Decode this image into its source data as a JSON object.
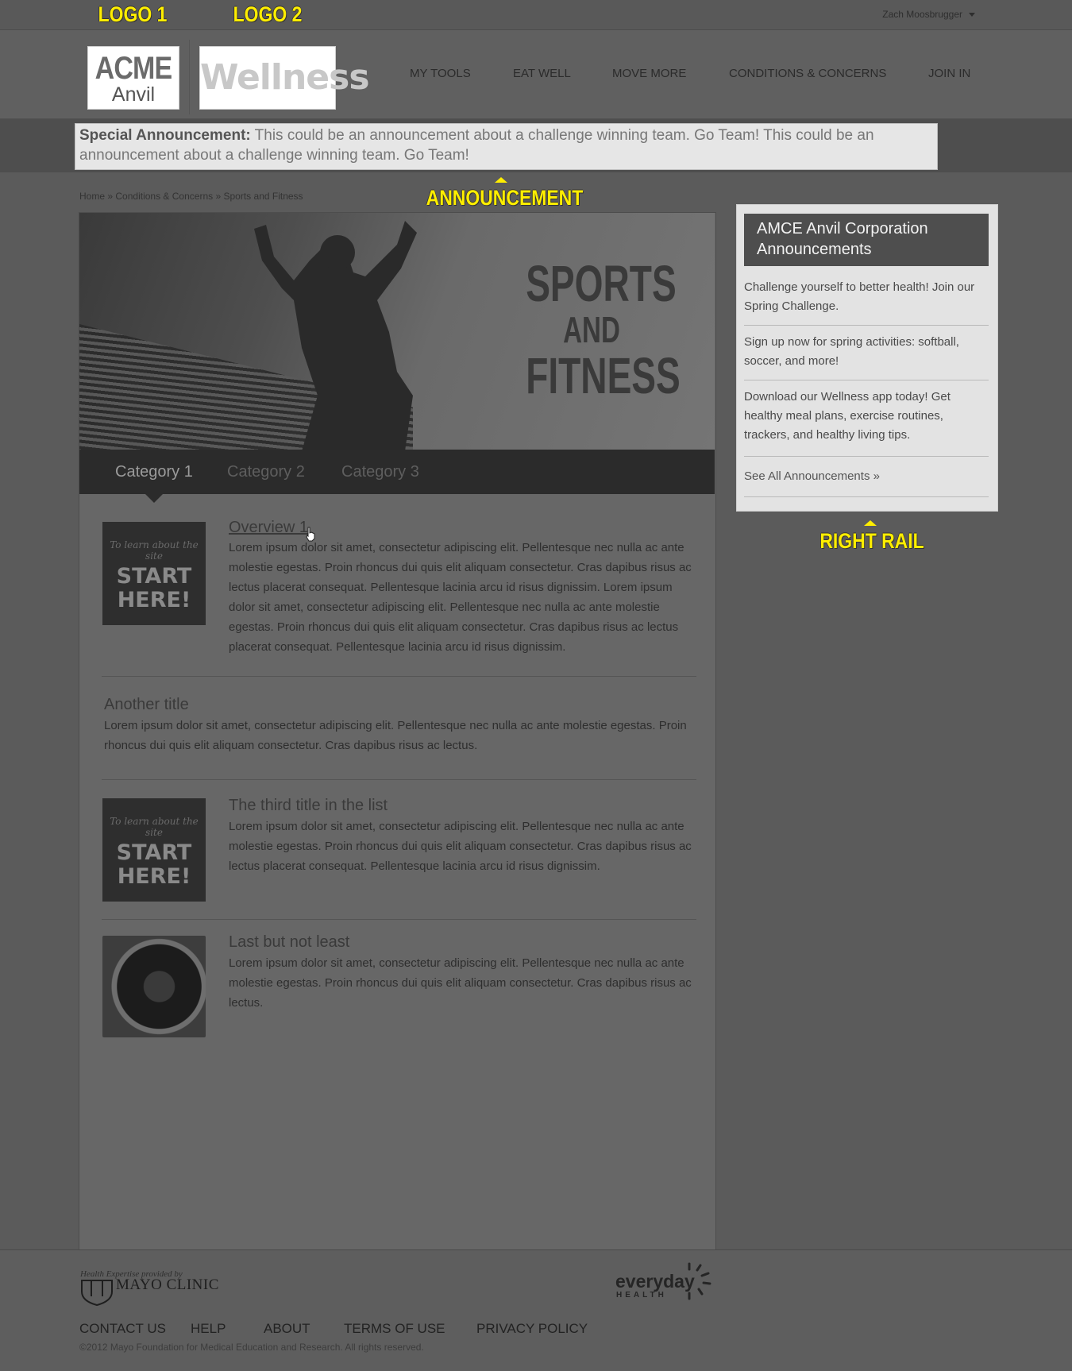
{
  "annotations": {
    "logo1": "LOGO 1",
    "logo2": "LOGO 2",
    "announcement": "ANNOUNCEMENT",
    "right_rail": "RIGHT RAIL"
  },
  "user": {
    "name": "Zach Moosbrugger"
  },
  "logos": {
    "acme_line1": "ACME",
    "acme_line2": "Anvil",
    "wellness": "Wellness"
  },
  "nav": [
    "MY TOOLS",
    "EAT WELL",
    "MOVE MORE",
    "CONDITIONS & CONCERNS",
    "JOIN IN"
  ],
  "announcement": {
    "label": "Special Announcement:",
    "text": " This could be an announcement about a challenge winning team. Go Team! This could be an announcement about a challenge winning team. Go Team!"
  },
  "breadcrumb": [
    "Home",
    "Conditions & Concerns",
    "Sports and Fitness"
  ],
  "breadcrumb_sep": "»",
  "hero": {
    "line1": "SPORTS",
    "line2": "AND",
    "line3": "FITNESS"
  },
  "tabs": [
    "Category 1",
    "Category 2",
    "Category 3"
  ],
  "thumb": {
    "small": "To learn about the site",
    "big1": "START",
    "big2": "HERE!"
  },
  "items": [
    {
      "title": "Overview 1",
      "body": "Lorem ipsum dolor sit amet, consectetur adipiscing elit. Pellentesque nec nulla ac ante molestie egestas. Proin rhoncus dui quis elit aliquam consectetur. Cras dapibus risus ac lectus placerat consequat. Pellentesque lacinia arcu id risus dignissim. Lorem ipsum dolor sit amet, consectetur adipiscing elit. Pellentesque nec nulla ac ante molestie egestas. Proin rhoncus dui quis elit aliquam consectetur. Cras dapibus risus ac lectus placerat consequat. Pellentesque lacinia arcu id risus dignissim."
    },
    {
      "title": "Another title",
      "body": "Lorem ipsum dolor sit amet, consectetur adipiscing elit. Pellentesque nec nulla ac ante molestie egestas. Proin rhoncus dui quis elit aliquam consectetur. Cras dapibus risus ac lectus."
    },
    {
      "title": "The third title in the list",
      "body": "Lorem ipsum dolor sit amet, consectetur adipiscing elit. Pellentesque nec nulla ac ante molestie egestas. Proin rhoncus dui quis elit aliquam consectetur. Cras dapibus risus ac lectus placerat consequat. Pellentesque lacinia arcu id risus dignissim."
    },
    {
      "title": "Last but not least",
      "body": "Lorem ipsum dolor sit amet, consectetur adipiscing elit. Pellentesque nec nulla ac ante molestie egestas. Proin rhoncus dui quis elit aliquam consectetur. Cras dapibus risus ac lectus."
    }
  ],
  "rail": {
    "title": "AMCE Anvil Corporation Announcements",
    "items": [
      "Challenge yourself to better health! Join our Spring Challenge.",
      "Sign up now for spring activities: softball, soccer, and more!",
      "Download our Wellness app today! Get healthy meal plans, exercise routines, trackers, and healthy living tips."
    ],
    "link": "See All Announcements »"
  },
  "footer": {
    "mayo_small": "Health Expertise provided by",
    "mayo_name": "MAYO CLINIC",
    "everyday": "everyday",
    "everyday_sub": "HEALTH",
    "links": [
      "CONTACT US",
      "HELP",
      "ABOUT",
      "TERMS OF USE",
      "PRIVACY POLICY"
    ],
    "copyright": "©2012 Mayo Foundation for Medical Education and Research. All rights reserved."
  },
  "colors": {
    "annotation_yellow": "#ffee00",
    "page_bg": "#5b5b5b",
    "rail_bg": "#e3e3e3",
    "tabs_bg": "#2b2b2b"
  }
}
